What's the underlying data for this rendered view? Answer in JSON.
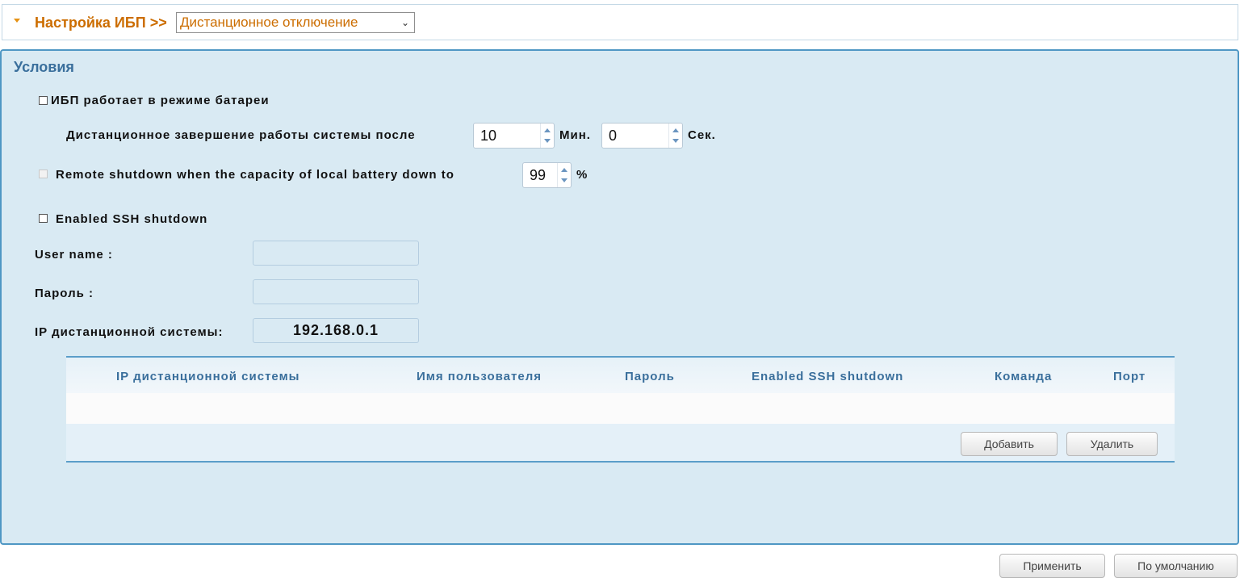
{
  "header": {
    "title": "Настройка ИБП >>",
    "select_value": "Дистанционное отключение"
  },
  "conditions": {
    "title": "Условия",
    "battery_mode_label": "ИБП работает в режиме батареи",
    "shutdown_after_label": "Дистанционное завершение работы системы после",
    "minutes_value": "10",
    "minutes_unit": "Мин.",
    "seconds_value": "0",
    "seconds_unit": "Сек.",
    "capacity_label": "Remote shutdown when the capacity of local battery down to",
    "capacity_value": "99",
    "capacity_unit": "%",
    "ssh_label": "Enabled SSH shutdown",
    "username_label": "User name :",
    "username_value": "",
    "password_label": "Пароль :",
    "password_value": "",
    "ip_label": "IP дистанционной системы:",
    "ip_value": "192.168.0.1"
  },
  "table": {
    "columns": [
      "IP дистанционной системы",
      "Имя пользователя",
      "Пароль",
      "Enabled SSH shutdown",
      "Команда",
      "Порт"
    ],
    "rows": [],
    "add_button": "Добавить",
    "delete_button": "Удалить"
  },
  "footer": {
    "apply_button": "Применить",
    "default_button": "По умолчанию"
  },
  "colors": {
    "accent_orange": "#cc6d00",
    "panel_bg": "#d9eaf3",
    "panel_border": "#4f97c4",
    "header_text_blue": "#3a6f9c"
  }
}
